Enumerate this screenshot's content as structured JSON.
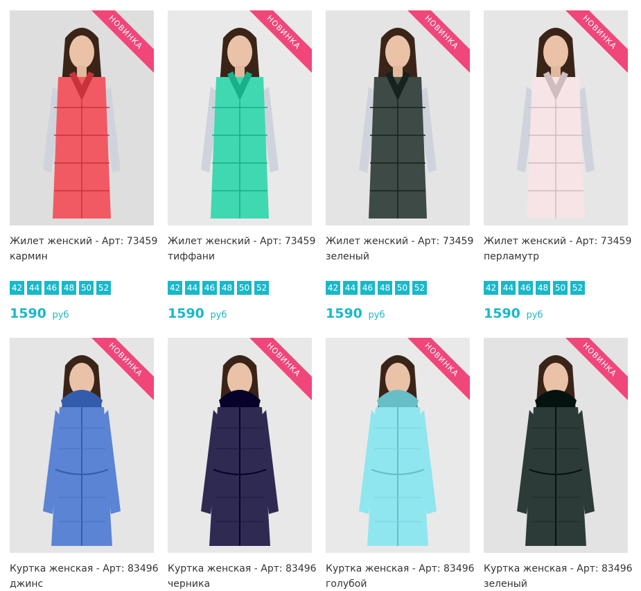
{
  "badge_label": "НОВИНКА",
  "currency": "руб",
  "products": [
    {
      "name": "Жилет женский - Арт: 73459",
      "color": "кармин",
      "sizes": [
        "42",
        "44",
        "46",
        "48",
        "50",
        "52"
      ],
      "price": "1590",
      "garment_hex": "#f25a63",
      "style": "vest",
      "backdrop": "#dedede"
    },
    {
      "name": "Жилет женский - Арт: 73459",
      "color": "тиффани",
      "sizes": [
        "42",
        "44",
        "46",
        "48",
        "50",
        "52"
      ],
      "price": "1590",
      "garment_hex": "#3fd8b0",
      "style": "vest",
      "backdrop": "#e9e9e9"
    },
    {
      "name": "Жилет женский - Арт: 73459",
      "color": "зеленый",
      "sizes": [
        "42",
        "44",
        "46",
        "48",
        "50",
        "52"
      ],
      "price": "1590",
      "garment_hex": "#3e4a45",
      "style": "vest",
      "backdrop": "#e4e4e4"
    },
    {
      "name": "Жилет женский - Арт: 73459",
      "color": "перламутр",
      "sizes": [
        "42",
        "44",
        "46",
        "48",
        "50",
        "52"
      ],
      "price": "1590",
      "garment_hex": "#f6e4e6",
      "style": "vest",
      "backdrop": "#e6e6e6"
    },
    {
      "name": "Куртка женская - Арт: 83496",
      "color": "джинс",
      "garment_hex": "#5b84d4",
      "style": "jacket",
      "backdrop": "#e5e5e5"
    },
    {
      "name": "Куртка женская - Арт: 83496",
      "color": "черника",
      "garment_hex": "#2e2a52",
      "style": "jacket",
      "backdrop": "#e8e8e8"
    },
    {
      "name": "Куртка женская - Арт: 83496",
      "color": "голубой",
      "garment_hex": "#8fe6ef",
      "style": "jacket",
      "backdrop": "#e9e9e9"
    },
    {
      "name": "Куртка женская - Арт: 83496",
      "color": "зеленый",
      "garment_hex": "#2c3b38",
      "style": "jacket",
      "backdrop": "#e3e3e3"
    }
  ]
}
